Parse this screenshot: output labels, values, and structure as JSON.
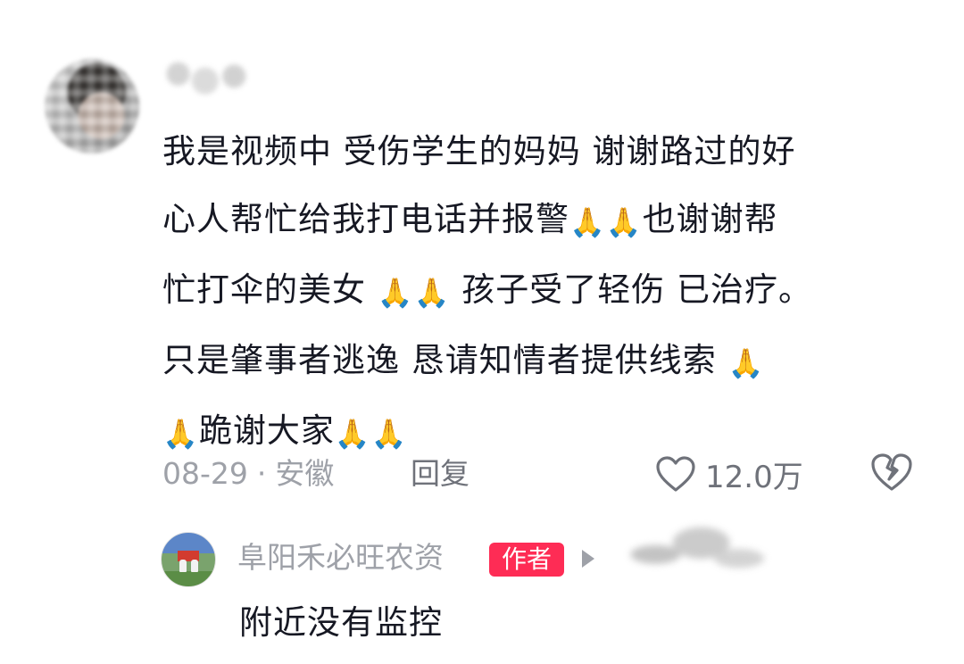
{
  "comment": {
    "lines": [
      [
        "我是视频中 受伤学生的妈妈 谢谢路过的好"
      ],
      [
        "心人帮忙给我打电话并报警",
        "🙏",
        "🙏",
        "也谢谢帮"
      ],
      [
        "忙打伞的美女 ",
        "🙏",
        "🙏",
        " 孩子受了轻伤 已治疗。"
      ],
      [
        "只是肇事者逃逸 恳请知情者提供线索 ",
        "🙏"
      ],
      [
        "🙏",
        "跪谢大家",
        "🙏",
        "🙏"
      ]
    ],
    "date": "08-29",
    "separator": "·",
    "location": "安徽",
    "reply_label": "回复",
    "like_count": "12.0万"
  },
  "reply": {
    "username": "阜阳禾必旺农资",
    "badge": "作者",
    "text": "附近没有监控"
  },
  "icons": {
    "like": "heart-outline-icon",
    "dislike": "broken-heart-icon",
    "emoji": "folded-hands"
  },
  "colors": {
    "text": "#161823",
    "muted": "#9ea1a8",
    "badge": "#fe2c55"
  }
}
